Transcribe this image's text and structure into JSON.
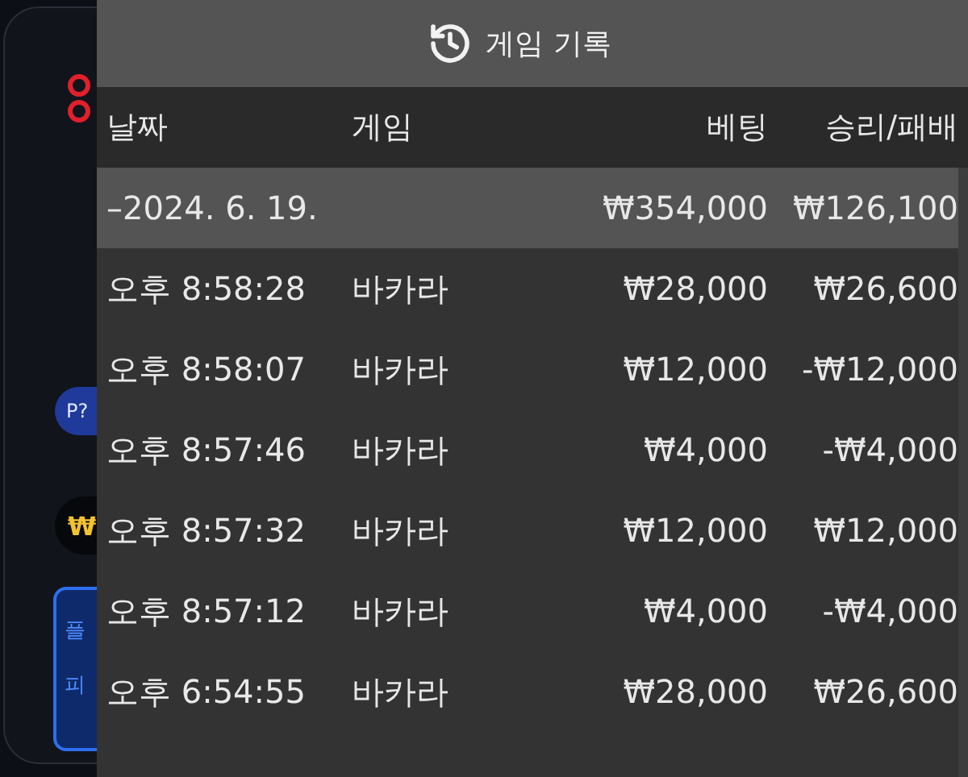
{
  "background": {
    "badge": "P?",
    "currency": "₩",
    "button_lines": [
      "플",
      "피"
    ]
  },
  "panel": {
    "title": "게임 기록"
  },
  "table": {
    "columns": [
      "날짜",
      "게임",
      "베팅",
      "승리/패배"
    ],
    "summary": {
      "date": "–2024. 6. 19.",
      "bet": "₩354,000",
      "result": "₩126,100"
    },
    "rows": [
      {
        "time": "오후 8:58:28",
        "game": "바카라",
        "bet": "₩28,000",
        "result": "₩26,600"
      },
      {
        "time": "오후 8:58:07",
        "game": "바카라",
        "bet": "₩12,000",
        "result": "-₩12,000"
      },
      {
        "time": "오후 8:57:46",
        "game": "바카라",
        "bet": "₩4,000",
        "result": "-₩4,000"
      },
      {
        "time": "오후 8:57:32",
        "game": "바카라",
        "bet": "₩12,000",
        "result": "₩12,000"
      },
      {
        "time": "오후 8:57:12",
        "game": "바카라",
        "bet": "₩4,000",
        "result": "-₩4,000"
      },
      {
        "time": "오후 6:54:55",
        "game": "바카라",
        "bet": "₩28,000",
        "result": "₩26,600"
      }
    ]
  }
}
